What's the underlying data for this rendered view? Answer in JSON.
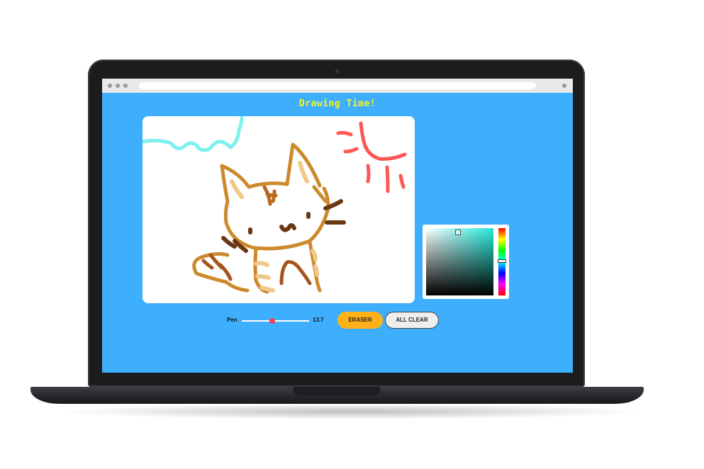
{
  "page": {
    "title": "Drawing Time!"
  },
  "toolbar": {
    "pen_label": "Pen",
    "pen_size": "13.7",
    "pen_size_fraction": 0.45,
    "eraser_label": "ERASER",
    "clear_label": "ALL CLEAR"
  },
  "color_picker": {
    "selected_hue": "#22eadc"
  },
  "colors": {
    "page_background": "#3eaffd",
    "title": "#f8f41f",
    "eraser_button": "#ffb11a",
    "slider_thumb": "#ff3b50"
  },
  "icons": {
    "browser_dots": [
      "window-dot-icon",
      "window-dot-icon",
      "window-dot-icon"
    ],
    "camera": "camera-icon"
  }
}
